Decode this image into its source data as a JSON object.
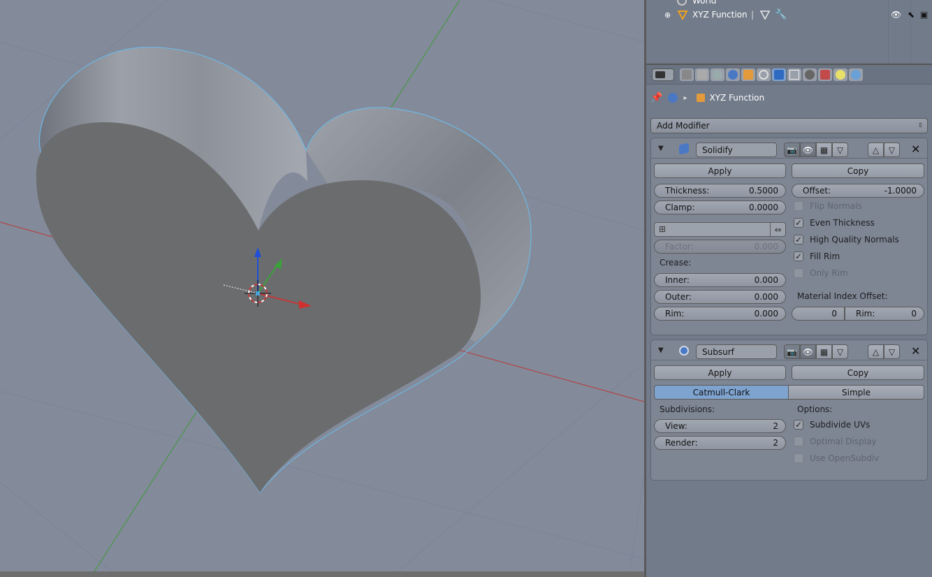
{
  "outliner": {
    "world_label": "World",
    "object_label": "XYZ Function"
  },
  "properties": {
    "tabs": [
      "render-icon",
      "render-layers-icon",
      "scene-icon",
      "world-icon",
      "object-icon",
      "constraints-icon",
      "modifiers-icon",
      "data-icon",
      "material-icon",
      "texture-icon",
      "particles-icon",
      "physics-icon"
    ],
    "context_label": "XYZ Function",
    "add_modifier_label": "Add Modifier",
    "solidify": {
      "name": "Solidify",
      "apply_label": "Apply",
      "copy_label": "Copy",
      "thickness_label": "Thickness:",
      "thickness_value": "0.5000",
      "clamp_label": "Clamp:",
      "clamp_value": "0.0000",
      "offset_label": "Offset:",
      "offset_value": "-1.0000",
      "factor_label": "Factor:",
      "factor_value": "0.000",
      "crease_label": "Crease:",
      "inner_label": "Inner:",
      "inner_value": "0.000",
      "outer_label": "Outer:",
      "outer_value": "0.000",
      "rim_label": "Rim:",
      "rim_value": "0.000",
      "flip_normals_label": "Flip Normals",
      "even_thickness_label": "Even Thickness",
      "high_quality_label": "High Quality Normals",
      "fill_rim_label": "Fill Rim",
      "only_rim_label": "Only Rim",
      "material_offset_label": "Material Index Offset:",
      "mat_offset_value": "0",
      "mat_rim_label": "Rim:",
      "mat_rim_value": "0"
    },
    "subsurf": {
      "name": "Subsurf",
      "apply_label": "Apply",
      "copy_label": "Copy",
      "catmull_label": "Catmull-Clark",
      "simple_label": "Simple",
      "subdivisions_label": "Subdivisions:",
      "view_label": "View:",
      "view_value": "2",
      "render_label": "Render:",
      "render_value": "2",
      "options_label": "Options:",
      "subdivide_uvs_label": "Subdivide UVs",
      "optimal_display_label": "Optimal Display",
      "use_opensubdiv_label": "Use OpenSubdiv"
    }
  },
  "colors": {
    "viewport_bg": "#838a99",
    "panel_bg": "#727b8a",
    "selected_tab": "#7fa3cf",
    "x_axis": "#c23a3a",
    "y_axis": "#3aa23a",
    "z_axis": "#1f4fd8"
  }
}
